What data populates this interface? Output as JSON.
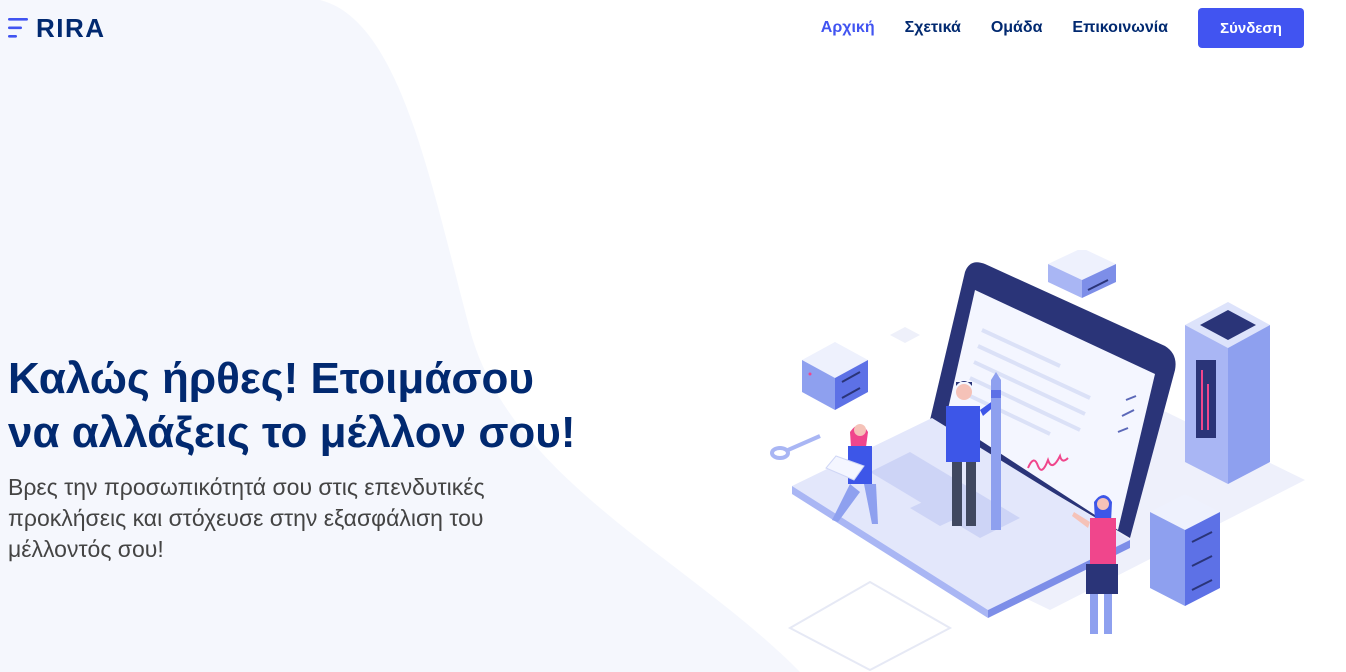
{
  "brand": {
    "name": "RIRA",
    "logo_icon": "menu-lines-icon"
  },
  "nav": {
    "items": [
      {
        "label": "Αρχική",
        "active": true
      },
      {
        "label": "Σχετικά",
        "active": false
      },
      {
        "label": "Ομάδα",
        "active": false
      },
      {
        "label": "Επικοινωνία",
        "active": false
      }
    ],
    "login_label": "Σύνδεση"
  },
  "hero": {
    "title_line1": "Καλώς ήρθες! Ετοιμάσου",
    "title_line2": "να αλλάξεις το μέλλον σου!",
    "subtitle": "Βρες την προσωπικότητά σου στις επενδυτικές προκλήσεις και στόχευσε στην εξασφάλιση του μέλλοντός σου!"
  },
  "illustration": {
    "icon": "laptop-signing-contract-illustration"
  },
  "colors": {
    "primary": "#4154f1",
    "heading": "#012970",
    "text": "#444444",
    "wave": "#f5f7fd",
    "accent_pink": "#f0468c"
  }
}
